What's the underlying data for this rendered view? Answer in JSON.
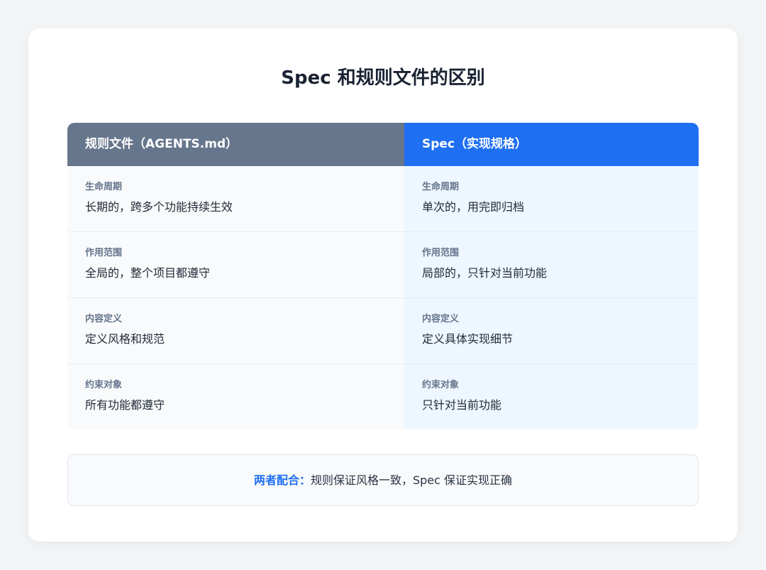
{
  "title": "Spec 和规则文件的区别",
  "colors": {
    "left_header": "#66768c",
    "right_header": "#1f6ff2",
    "left_body": "#f8fafc",
    "right_body": "#eef6ff",
    "accent": "#1f6ff2"
  },
  "columns": [
    {
      "header": "规则文件（AGENTS.md）",
      "rows": [
        {
          "label": "生命周期",
          "value": "长期的，跨多个功能持续生效"
        },
        {
          "label": "作用范围",
          "value": "全局的，整个项目都遵守"
        },
        {
          "label": "内容定义",
          "value": "定义风格和规范"
        },
        {
          "label": "约束对象",
          "value": "所有功能都遵守"
        }
      ]
    },
    {
      "header": "Spec（实现规格）",
      "rows": [
        {
          "label": "生命周期",
          "value": "单次的，用完即归档"
        },
        {
          "label": "作用范围",
          "value": "局部的，只针对当前功能"
        },
        {
          "label": "内容定义",
          "value": "定义具体实现细节"
        },
        {
          "label": "约束对象",
          "value": "只针对当前功能"
        }
      ]
    }
  ],
  "note": {
    "label": "两者配合：",
    "text": "规则保证风格一致，Spec 保证实现正确"
  }
}
